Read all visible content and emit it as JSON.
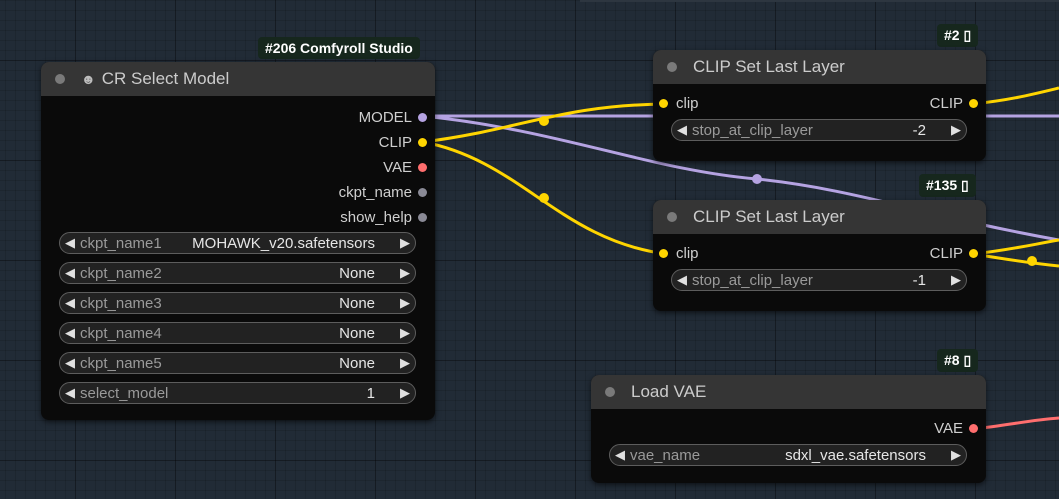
{
  "colors": {
    "model": "#b5a3e2",
    "clip": "#ffd500",
    "vae": "#ff6e6e",
    "string": "#9a9a9a"
  },
  "cr_select_model": {
    "badge": "#206 Comfyroll Studio",
    "icon": "avatar-icon",
    "title": "CR Select Model",
    "outputs": [
      "MODEL",
      "CLIP",
      "VAE",
      "ckpt_name",
      "show_help"
    ],
    "widgets": [
      {
        "label": "ckpt_name1",
        "value": "MOHAWK_v20.safetensors"
      },
      {
        "label": "ckpt_name2",
        "value": "None"
      },
      {
        "label": "ckpt_name3",
        "value": "None"
      },
      {
        "label": "ckpt_name4",
        "value": "None"
      },
      {
        "label": "ckpt_name5",
        "value": "None"
      },
      {
        "label": "select_model",
        "value": "1"
      }
    ]
  },
  "clip_set_last_layer_1": {
    "badge": "#2 ▯",
    "title": "CLIP Set Last Layer",
    "input": "clip",
    "output": "CLIP",
    "widget": {
      "label": "stop_at_clip_layer",
      "value": "-2"
    }
  },
  "clip_set_last_layer_2": {
    "badge": "#135 ▯",
    "title": "CLIP Set Last Layer",
    "input": "clip",
    "output": "CLIP",
    "widget": {
      "label": "stop_at_clip_layer",
      "value": "-1"
    }
  },
  "load_vae": {
    "badge": "#8 ▯",
    "title": "Load VAE",
    "output": "VAE",
    "widget": {
      "label": "vae_name",
      "value": "sdxl_vae.safetensors"
    }
  },
  "arrows": {
    "left": "◀",
    "right": "▶"
  }
}
